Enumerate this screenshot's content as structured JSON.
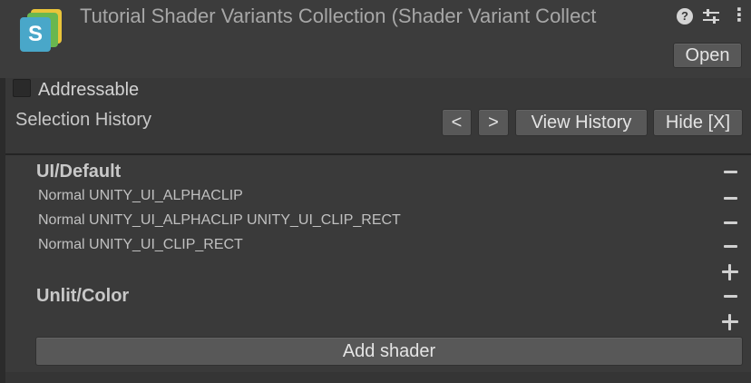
{
  "inspector": {
    "title": "Tutorial Shader Variants Collection (Shader Variant Collect",
    "icon_letter": "S",
    "help_icon_glyph": "?",
    "more_icon_glyph": "⋮",
    "open_label": "Open"
  },
  "addressable": {
    "label": "Addressable",
    "checked": false
  },
  "selection_history": {
    "label": "Selection History",
    "prev_label": "<",
    "next_label": ">",
    "view_history_label": "View History",
    "hide_label": "Hide [X]"
  },
  "shaders": [
    {
      "name": "UI/Default",
      "variants": [
        "Normal UNITY_UI_ALPHACLIP",
        "Normal UNITY_UI_ALPHACLIP UNITY_UI_CLIP_RECT",
        "Normal UNITY_UI_CLIP_RECT"
      ]
    },
    {
      "name": "Unlit/Color",
      "variants": []
    }
  ],
  "add_shader_label": "Add shader",
  "icons": {
    "asset": "shader-variant-collection-icon",
    "help": "help-icon",
    "settings": "preset-sliders-icon",
    "more": "kebab-menu-icon",
    "remove": "minus-icon",
    "add": "plus-icon"
  },
  "colors": {
    "background": "#383838",
    "button": "#585858",
    "icon_blue": "#49a7c9",
    "icon_green": "#69b74f",
    "icon_yellow": "#e9c43a"
  }
}
